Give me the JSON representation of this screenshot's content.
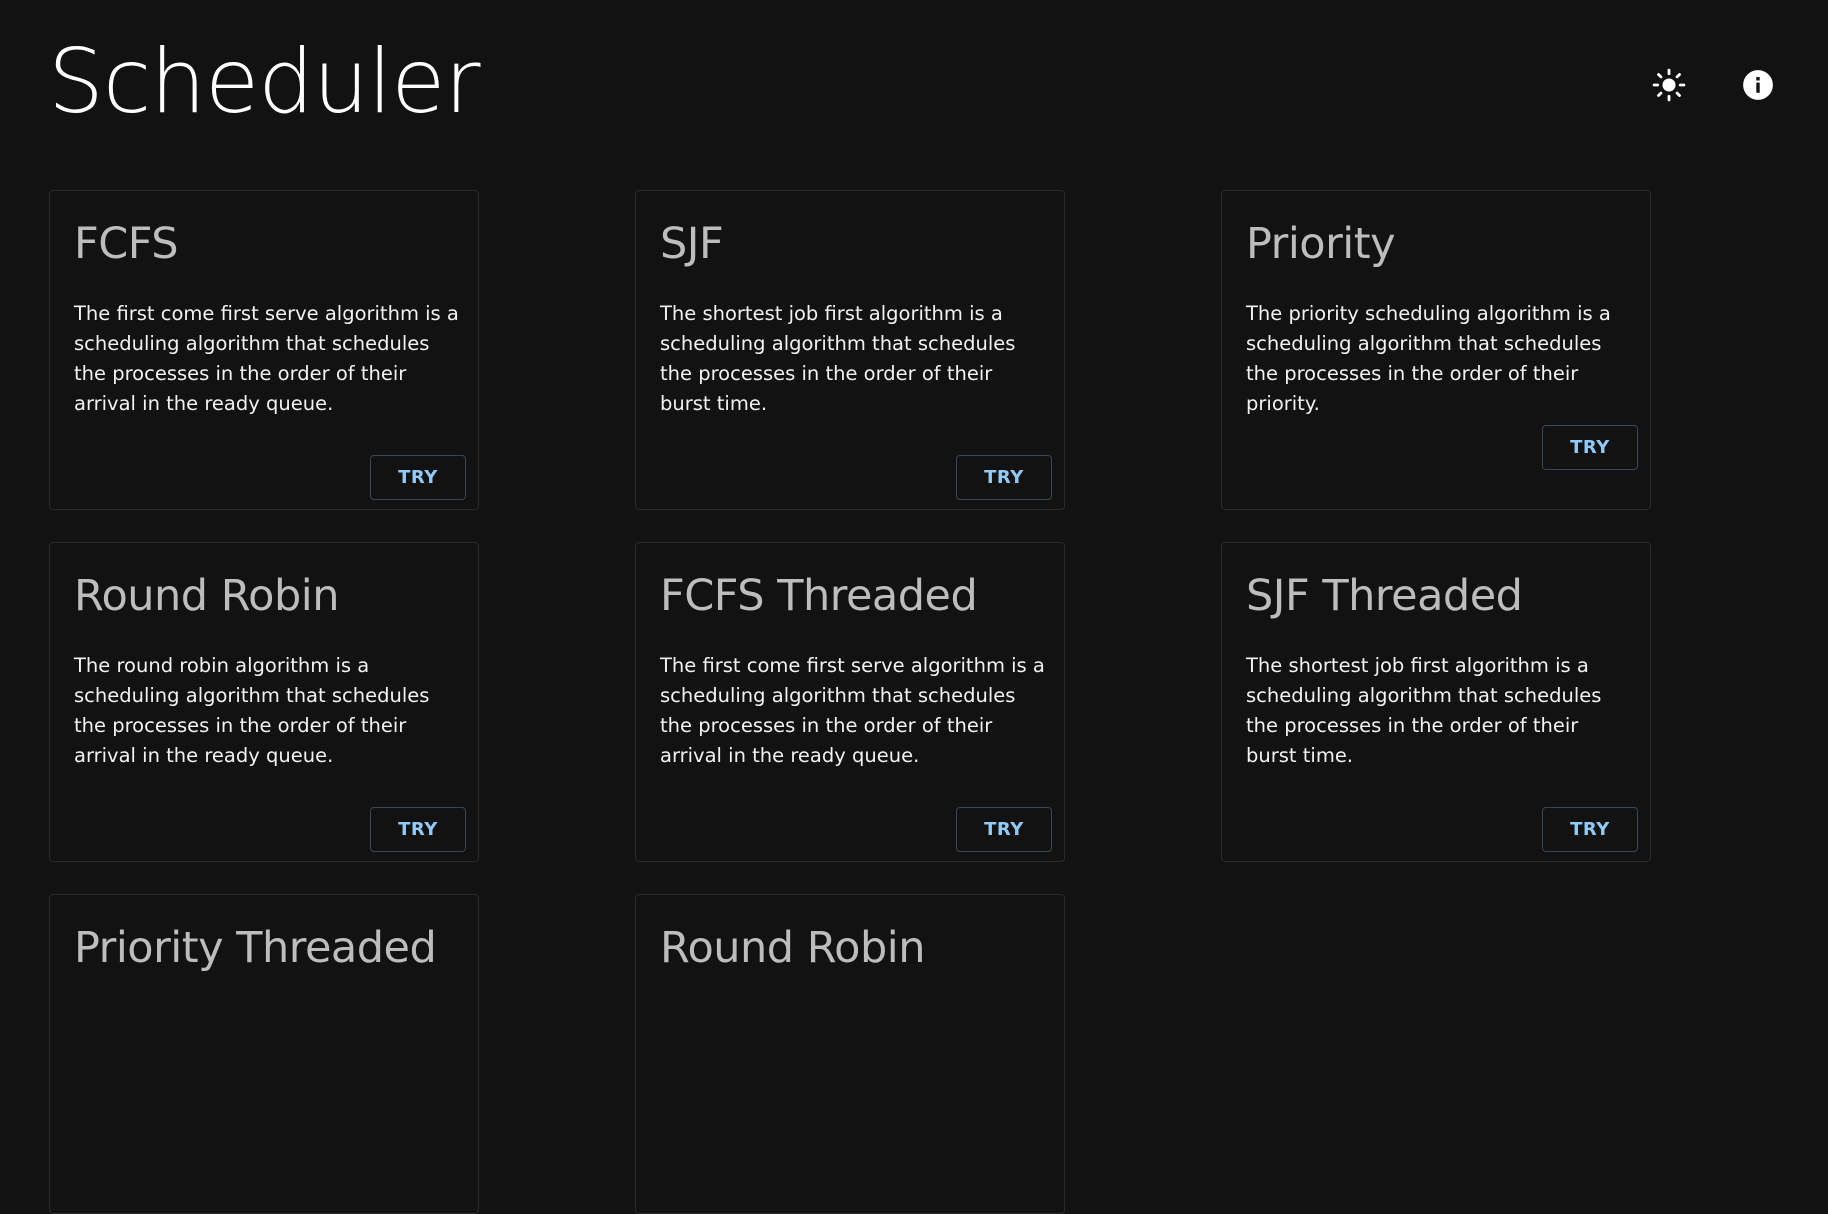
{
  "app": {
    "title": "Scheduler"
  },
  "header": {
    "theme_toggle_icon": "sun-icon",
    "info_icon": "info-icon"
  },
  "colors": {
    "background": "#121212",
    "card_border": "#2b2b2b",
    "card_title": "#bdbdbd",
    "card_text": "#f2f2f2",
    "button_text": "#90caf9"
  },
  "cards": [
    {
      "title": "FCFS",
      "description": "The first come first serve algorithm is a scheduling algorithm that schedules the processes in the order of their arrival in the ready queue.",
      "button_label": "TRY"
    },
    {
      "title": "SJF",
      "description": "The shortest job first algorithm is a scheduling algorithm that schedules the processes in the order of their burst time.",
      "button_label": "TRY"
    },
    {
      "title": "Priority",
      "description": "The priority scheduling algorithm is a scheduling algorithm that schedules the processes in the order of their priority.",
      "button_label": "TRY"
    },
    {
      "title": "Round Robin",
      "description": "The round robin algorithm is a scheduling algorithm that schedules the processes in the order of their arrival in the ready queue.",
      "button_label": "TRY"
    },
    {
      "title": "FCFS Threaded",
      "description": "The first come first serve algorithm is a scheduling algorithm that schedules the processes in the order of their arrival in the ready queue.",
      "button_label": "TRY"
    },
    {
      "title": "SJF Threaded",
      "description": "The shortest job first algorithm is a scheduling algorithm that schedules the processes in the order of their burst time.",
      "button_label": "TRY"
    },
    {
      "title": "Priority Threaded",
      "description": "",
      "button_label": ""
    },
    {
      "title": "Round Robin",
      "description": "",
      "button_label": ""
    }
  ]
}
